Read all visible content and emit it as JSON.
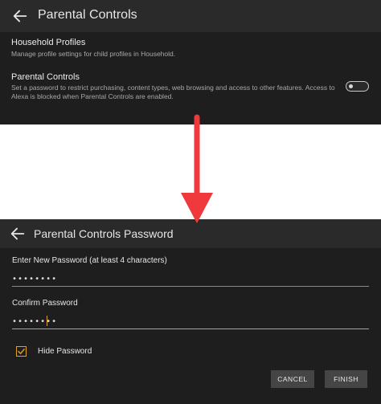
{
  "colors": {
    "background": "#1e1e1e",
    "header": "#2a2a2a",
    "accent": "#e0a020",
    "arrow": "#f0393c"
  },
  "top_screen": {
    "title": "Parental Controls",
    "back_icon": "arrow-left-icon",
    "household": {
      "title": "Household Profiles",
      "description": "Manage profile settings for child profiles in Household."
    },
    "parental": {
      "title": "Parental Controls",
      "description": "Set a password to restrict purchasing, content types, web browsing and access to other features. Access to Alexa is blocked when Parental Controls are enabled.",
      "toggle_on": false
    }
  },
  "bottom_screen": {
    "title": "Parental Controls Password",
    "back_icon": "arrow-left-icon",
    "new_password_label": "Enter New Password (at least 4 characters)",
    "new_password_value": "••••••••",
    "confirm_password_label": "Confirm Password",
    "confirm_password_value": "••••••••",
    "hide_password_label": "Hide Password",
    "hide_password_checked": true,
    "cancel_label": "CANCEL",
    "finish_label": "FINISH"
  }
}
